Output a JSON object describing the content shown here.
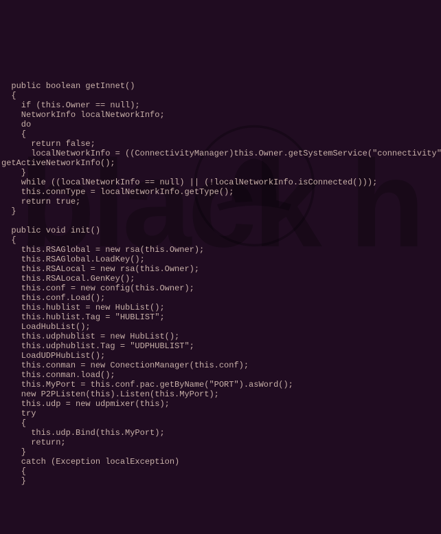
{
  "code_lines": [
    "  public boolean getInnet()",
    "  {",
    "    if (this.Owner == null);",
    "    NetworkInfo localNetworkInfo;",
    "    do",
    "    {",
    "      return false;",
    "      localNetworkInfo = ((ConnectivityManager)this.Owner.getSystemService(\"connectivity\")).",
    "getActiveNetworkInfo();",
    "    }",
    "    while ((localNetworkInfo == null) || (!localNetworkInfo.isConnected()));",
    "    this.connType = localNetworkInfo.getType();",
    "    return true;",
    "  }",
    "",
    "  public void init()",
    "  {",
    "    this.RSAGlobal = new rsa(this.Owner);",
    "    this.RSAGlobal.LoadKey();",
    "    this.RSALocal = new rsa(this.Owner);",
    "    this.RSALocal.GenKey();",
    "    this.conf = new config(this.Owner);",
    "    this.conf.Load();",
    "    this.hublist = new HubList();",
    "    this.hublist.Tag = \"HUBLIST\";",
    "    LoadHubList();",
    "    this.udphublist = new HubList();",
    "    this.udphublist.Tag = \"UDPHUBLIST\";",
    "    LoadUDPHubList();",
    "    this.conman = new ConectionManager(this.conf);",
    "    this.conman.load();",
    "    this.MyPort = this.conf.pac.getByName(\"PORT\").asWord();",
    "    new P2PListen(this).Listen(this.MyPort);",
    "    this.udp = new udpmixer(this);",
    "    try",
    "    {",
    "      this.udp.Bind(this.MyPort);",
    "      return;",
    "    }",
    "    catch (Exception localException)",
    "    {",
    "    }"
  ],
  "watermark_text": "black h"
}
